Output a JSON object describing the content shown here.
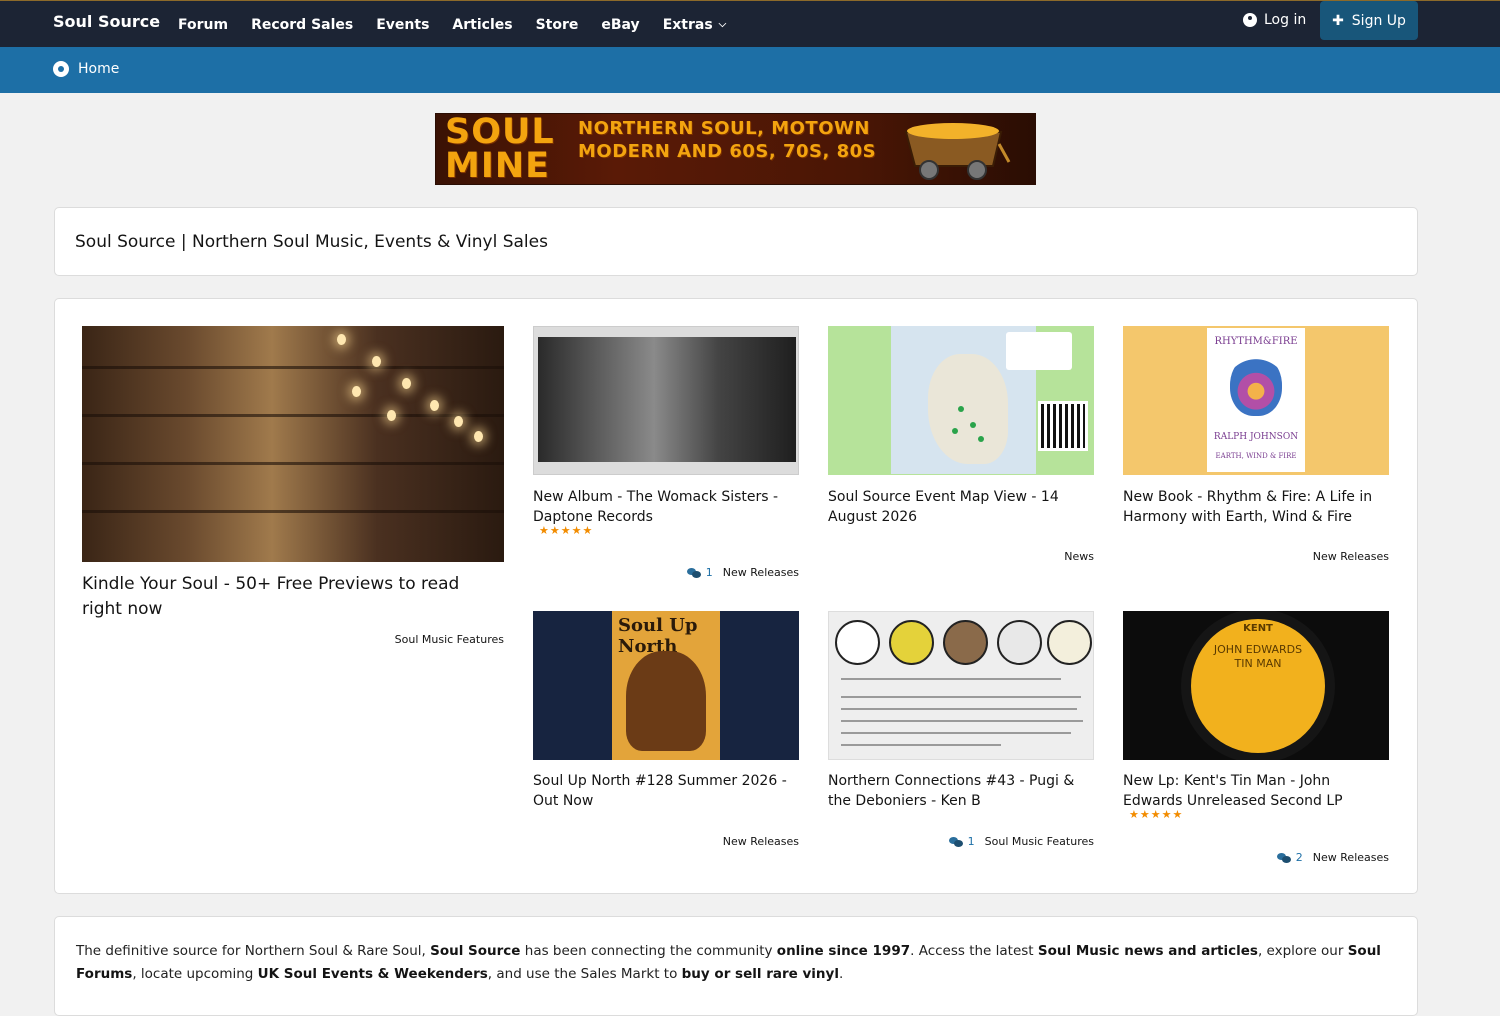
{
  "topnav": {
    "brand": "Soul Source",
    "items": [
      "Forum",
      "Record Sales",
      "Events",
      "Articles",
      "Store",
      "eBay",
      "Extras"
    ],
    "login": "Log in",
    "signup": "Sign Up"
  },
  "breadcrumb": {
    "home": "Home"
  },
  "banner": {
    "logo_line1": "SOUL",
    "logo_line2": "MINE",
    "tagline_line1": "NORTHERN SOUL, MOTOWN",
    "tagline_line2": "MODERN AND 60S, 70S, 80S"
  },
  "page": {
    "title": "Soul Source | Northern Soul Music, Events & Vinyl Sales"
  },
  "articles": [
    {
      "title": "Kindle Your Soul - 50+ Free Previews to read right now",
      "category": "Soul Music Features",
      "comments": "",
      "stars": ""
    },
    {
      "title": "New Album - The Womack Sisters - Daptone Records",
      "category": "New Releases",
      "comments": "1",
      "stars": "★★★★★"
    },
    {
      "title": "Soul Source Event Map View - 14 August 2026",
      "category": "News",
      "comments": "",
      "stars": ""
    },
    {
      "title": "New Book - Rhythm & Fire: A Life in Harmony with Earth, Wind & Fire",
      "category": "New Releases",
      "comments": "",
      "stars": ""
    },
    {
      "title": "Soul Up North #128 Summer 2026 - Out Now",
      "category": "New Releases",
      "comments": "",
      "stars": ""
    },
    {
      "title": "Northern Connections #43 - Pugi & the Deboniers - Ken B",
      "category": "Soul Music Features",
      "comments": "1",
      "stars": ""
    },
    {
      "title": "New Lp: Kent's Tin Man - John Edwards Unreleased Second LP",
      "category": "New Releases",
      "comments": "2",
      "stars": "★★★★★"
    }
  ],
  "thumbs": {
    "rhythm_title": "RHYTHM&FIRE",
    "rhythm_author": "RALPH JOHNSON",
    "rhythm_sub": "EARTH, WIND & FIRE",
    "soulup_title": "Soul Up North",
    "kent_brand": "KENT",
    "kent_title": "JOHN EDWARDS",
    "kent_sub": "TIN MAN"
  },
  "footer": {
    "t1": "The definitive source for Northern Soul & Rare Soul, ",
    "b1": "Soul Source",
    "t2": " has been connecting the community ",
    "b2": "online since 1997",
    "t3": ". Access the latest ",
    "b3": "Soul Music news and articles",
    "t4": ", explore our ",
    "b4": "Soul Forums",
    "t5": ", locate upcoming ",
    "b5": "UK Soul Events & Weekenders",
    "t6": ", and use the Sales Markt to ",
    "b6": "buy or sell rare vinyl",
    "t7": "."
  },
  "colors": {
    "topbar": "#1c2434",
    "breadcrumb_bar": "#1d6fa6",
    "signup_button": "#18567a",
    "star": "#f28c00"
  }
}
